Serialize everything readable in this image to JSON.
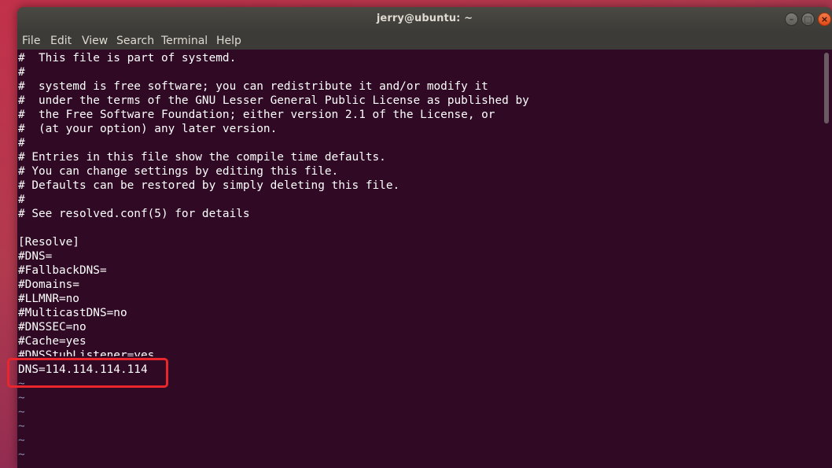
{
  "window": {
    "title": "jerry@ubuntu: ~"
  },
  "colors": {
    "terminal_bg": "#300a24",
    "titlebar_bg": "#3c3b37",
    "close_button": "#df4a16",
    "annotation_box": "#e8262b"
  },
  "window_buttons": {
    "minimize_icon": "minimize-icon",
    "maximize_icon": "maximize-icon",
    "close_icon": "close-icon"
  },
  "menu": {
    "items": [
      "File",
      "Edit",
      "View",
      "Search",
      "Terminal",
      "Help"
    ]
  },
  "terminal": {
    "lines": [
      "#  This file is part of systemd.",
      "#",
      "#  systemd is free software; you can redistribute it and/or modify it",
      "#  under the terms of the GNU Lesser General Public License as published by",
      "#  the Free Software Foundation; either version 2.1 of the License, or",
      "#  (at your option) any later version.",
      "#",
      "# Entries in this file show the compile time defaults.",
      "# You can change settings by editing this file.",
      "# Defaults can be restored by simply deleting this file.",
      "#",
      "# See resolved.conf(5) for details",
      "",
      "[Resolve]",
      "#DNS=",
      "#FallbackDNS=",
      "#Domains=",
      "#LLMNR=no",
      "#MulticastDNS=no",
      "#DNSSEC=no",
      "#Cache=yes",
      "#DNSStubListener=yes",
      "DNS=114.114.114.114"
    ],
    "empty_line_markers": [
      "~",
      "~",
      "~",
      "~",
      "~",
      "~"
    ]
  }
}
